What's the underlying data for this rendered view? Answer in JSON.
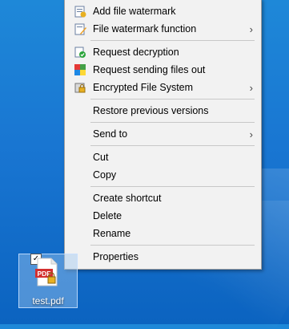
{
  "context_menu": {
    "items": [
      {
        "label": "Add file watermark",
        "icon": "watermark-add-icon"
      },
      {
        "label": "File watermark function",
        "icon": "watermark-edit-icon",
        "submenu": true
      },
      {
        "label": "Request decryption",
        "icon": "decrypt-icon"
      },
      {
        "label": "Request sending files out",
        "icon": "send-out-icon"
      },
      {
        "label": "Encrypted File System",
        "icon": "encrypted-fs-icon",
        "submenu": true
      },
      {
        "label": "Restore previous versions"
      },
      {
        "label": "Send to",
        "submenu": true
      },
      {
        "label": "Cut"
      },
      {
        "label": "Copy"
      },
      {
        "label": "Create shortcut"
      },
      {
        "label": "Delete"
      },
      {
        "label": "Rename"
      },
      {
        "label": "Properties"
      }
    ],
    "submenu_arrow": "›"
  },
  "desktop": {
    "file_name": "test.pdf",
    "file_icon": "pdf-icon",
    "badge_text": "PDF",
    "checkbox_mark": "✓"
  }
}
